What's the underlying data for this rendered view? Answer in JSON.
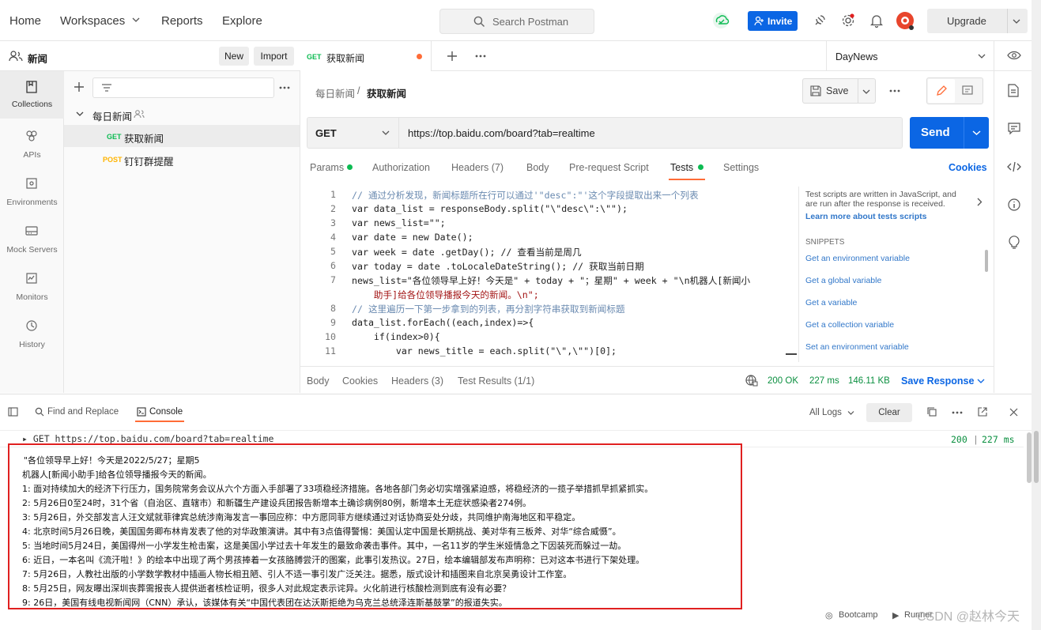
{
  "topbar": {
    "nav": [
      "Home",
      "Workspaces",
      "Reports",
      "Explore"
    ],
    "search_placeholder": "Search Postman",
    "invite_label": "Invite",
    "upgrade_label": "Upgrade"
  },
  "sidebar": {
    "workspace_name": "新闻",
    "new_label": "New",
    "import_label": "Import",
    "items": [
      {
        "label": "Collections",
        "icon": "collections-icon"
      },
      {
        "label": "APIs",
        "icon": "apis-icon"
      },
      {
        "label": "Environments",
        "icon": "environments-icon"
      },
      {
        "label": "Mock Servers",
        "icon": "mock-servers-icon"
      },
      {
        "label": "Monitors",
        "icon": "monitors-icon"
      },
      {
        "label": "History",
        "icon": "history-icon"
      }
    ],
    "collection_name": "每日新闻",
    "requests": [
      {
        "method": "GET",
        "name": "获取新闻"
      },
      {
        "method": "POST",
        "name": "钉钉群提醒"
      }
    ]
  },
  "tabs": {
    "active_method": "GET",
    "active_name": "获取新闻",
    "environment": "DayNews"
  },
  "breadcrumb": {
    "parent": "每日新闻",
    "separator": "/",
    "current": "获取新闻",
    "save_label": "Save"
  },
  "request": {
    "method": "GET",
    "url": "https://top.baidu.com/board?tab=realtime",
    "send_label": "Send",
    "subtabs": [
      "Params",
      "Authorization",
      "Headers (7)",
      "Body",
      "Pre-request Script",
      "Tests",
      "Settings"
    ],
    "active_subtab": "Tests",
    "cookies_label": "Cookies"
  },
  "editor_lines": [
    "1",
    "2",
    "3",
    "4",
    "5",
    "6",
    "7",
    "",
    "8",
    "9",
    "10",
    "11"
  ],
  "editor_code": [
    "// 通过分析发现，新闻标题所在行可以通过'\"desc\":\"'这个字段提取出来一个列表",
    "var data_list = responseBody.split(\"\\\"desc\\\":\\\"\");",
    "var news_list=\"\";",
    "var date = new Date();",
    "var week = date .getDay(); // 查看当前是周几",
    "var today = date .toLocaleDateString(); // 获取当前日期",
    "news_list=\"各位领导早上好！今天是\" + today + \"；星期\" + week + \"\\n机器人[新闻小",
    "    助手]给各位领导播报今天的新闻。\\n\";",
    "// 这里遍历一下第一步拿到的列表，再分割字符串获取到新闻标题",
    "data_list.forEach((each,index)=>{",
    "    if(index>0){",
    "        var news_title = each.split(\"\\\",\\\"\")[0];"
  ],
  "snippets": {
    "intro": "Test scripts are written in JavaScript, and are run after the response is received.",
    "learn_more": "Learn more about tests scripts",
    "heading": "SNIPPETS",
    "items": [
      "Get an environment variable",
      "Get a global variable",
      "Get a variable",
      "Get a collection variable",
      "Set an environment variable"
    ]
  },
  "response": {
    "tabs": [
      "Body",
      "Cookies",
      "Headers (3)",
      "Test Results (1/1)"
    ],
    "status": "200 OK",
    "time": "227 ms",
    "size": "146.11 KB",
    "save_label": "Save Response"
  },
  "console": {
    "find_replace": "Find and Replace",
    "console_label": "Console",
    "all_logs": "All Logs",
    "clear_label": "Clear",
    "request_line": "▸ GET https://top.baidu.com/board?tab=realtime",
    "request_status": "200",
    "request_time": "227 ms",
    "log_lines": [
      "\"各位领导早上好！今天是2022/5/27；星期5",
      "机器人[新闻小助手]给各位领导播报今天的新闻。",
      "1:   面对持续加大的经济下行压力，国务院常务会议从六个方面入手部署了33项稳经济措施。各地各部门务必切实增强紧迫感，将稳经济的一揽子举措抓早抓紧抓实。",
      "2:   5月26日0至24时，31个省（自治区、直辖市）和新疆生产建设兵团报告新增本土确诊病例80例，新增本土无症状感染者274例。",
      "3:   5月26日，外交部发言人汪文斌就菲律宾总统涉南海发言一事回应称：中方愿同菲方继续通过对话协商妥处分歧，共同维护南海地区和平稳定。",
      "4:   北京时间5月26日晚，美国国务卿布林肯发表了他的对华政策演讲。其中有3点值得警惕：美国认定中国是长期挑战、美对华有三板斧、对华“综合威慑”。",
      "5:   当地时间5月24日，美国得州一小学发生枪击案，这是美国小学过去十年发生的最致命袭击事件。其中，一名11岁的学生米娅情急之下因装死而躲过一劫。",
      "6:   近日，一本名叫《流汗啦！》的绘本中出现了两个男孩捧着一女孩胳膊尝汗的图案，此事引发热议。27日，绘本编辑部发布声明称：已对这本书进行下架处理。",
      "7:   5月26日，人教社出版的小学数学教材中插画人物长相丑陋、引人不适一事引发广泛关注。据悉，版式设计和插图来自北京吴勇设计工作室。",
      "8:   5月25日，网友曝出深圳丧葬需报丧人提供逝者核检证明，很多人对此规定表示诧异。火化前进行核酸检测到底有没有必要？",
      "9:   26日，美国有线电视新闻网（CNN）承认，该媒体有关“中国代表团在达沃斯拒绝为乌克兰总统泽连斯基鼓掌”的报道失实。"
    ]
  },
  "footer": {
    "bootcamp": "Bootcamp",
    "runner": "Runner",
    "watermark": "CSDN @赵林今天"
  },
  "colors": {
    "accent": "#0b66e4",
    "get": "#0cbb52",
    "post": "#ffb400",
    "highlight_border": "#e02020",
    "orange": "#ff6c37"
  }
}
